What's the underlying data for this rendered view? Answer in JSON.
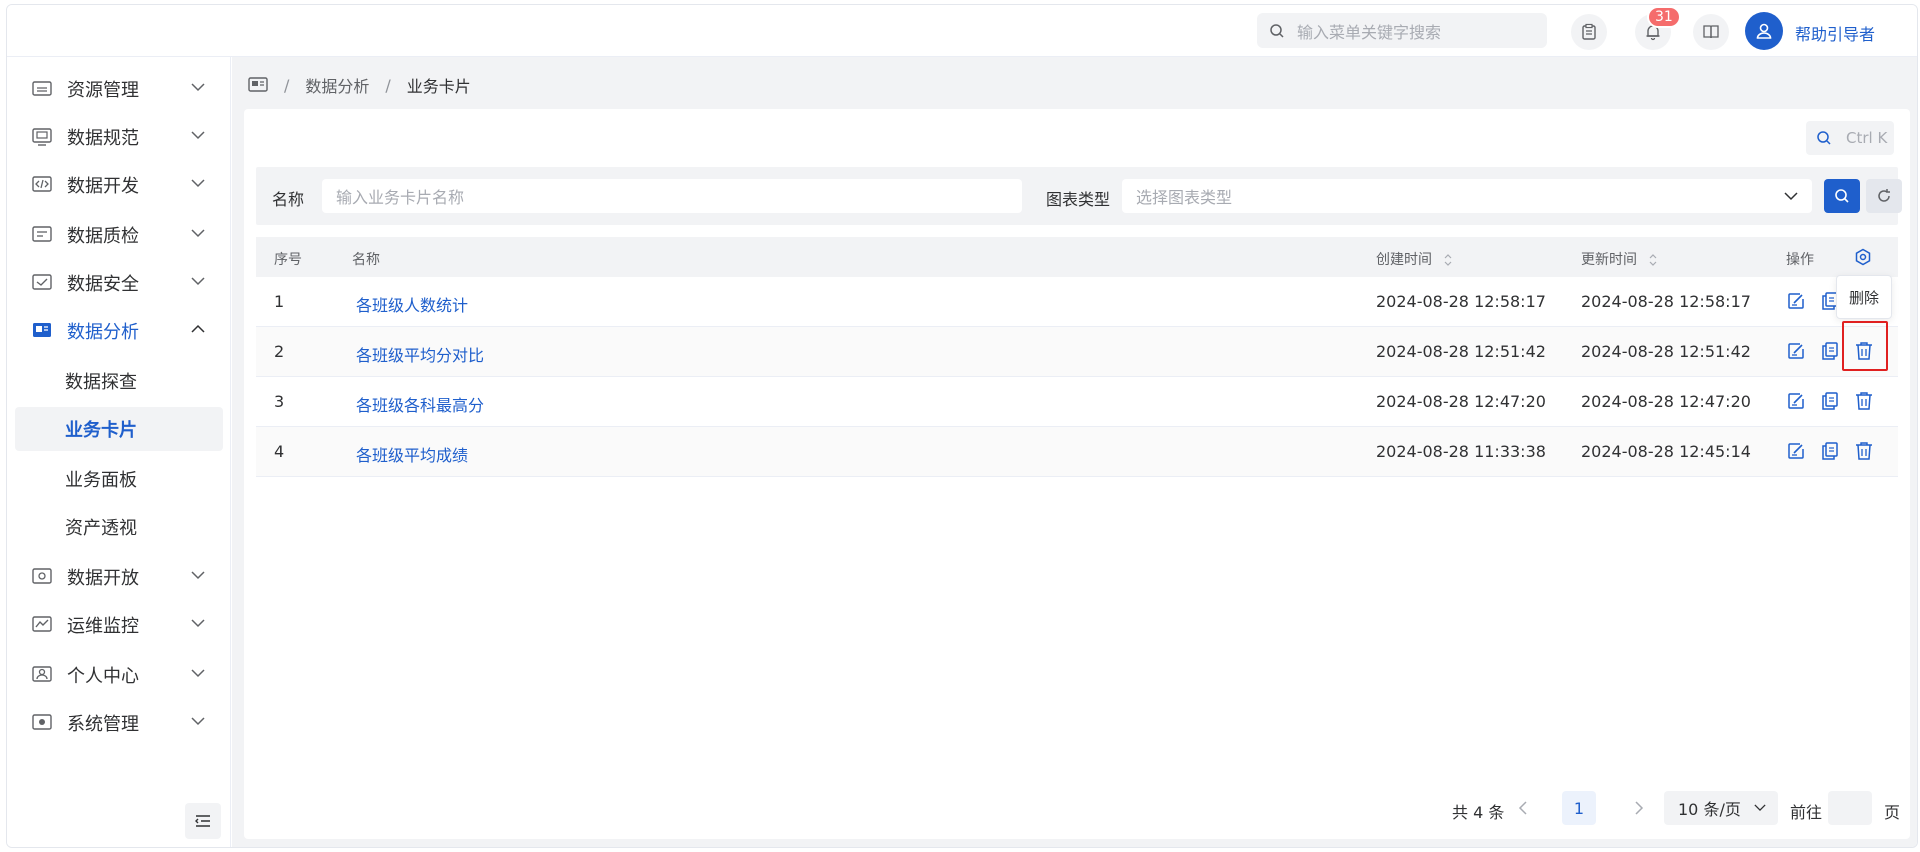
{
  "header": {
    "search_placeholder": "输入菜单关键字搜索",
    "notification_count": "31",
    "user_name": "帮助引导者"
  },
  "sidebar": {
    "items": [
      {
        "label": "资源管理",
        "icon": "resource-icon"
      },
      {
        "label": "数据规范",
        "icon": "standard-icon"
      },
      {
        "label": "数据开发",
        "icon": "code-icon"
      },
      {
        "label": "数据质检",
        "icon": "quality-icon"
      },
      {
        "label": "数据安全",
        "icon": "security-icon"
      },
      {
        "label": "数据分析",
        "icon": "analysis-icon"
      },
      {
        "label": "数据开放",
        "icon": "open-icon"
      },
      {
        "label": "运维监控",
        "icon": "monitor-icon"
      },
      {
        "label": "个人中心",
        "icon": "user-center-icon"
      },
      {
        "label": "系统管理",
        "icon": "system-icon"
      }
    ],
    "sub_items": [
      "数据探查",
      "业务卡片",
      "业务面板",
      "资产透视"
    ]
  },
  "breadcrumb": [
    "数据分析",
    "业务卡片"
  ],
  "toolbar": {
    "shortcut": "Ctrl K"
  },
  "filter": {
    "name_label": "名称",
    "name_placeholder": "输入业务卡片名称",
    "type_label": "图表类型",
    "type_placeholder": "选择图表类型"
  },
  "table": {
    "columns": {
      "index": "序号",
      "name": "名称",
      "created": "创建时间",
      "updated": "更新时间",
      "ops": "操作"
    },
    "rows": [
      {
        "index": "1",
        "name": "各班级人数统计",
        "created": "2024-08-28 12:58:17",
        "updated": "2024-08-28 12:58:17"
      },
      {
        "index": "2",
        "name": "各班级平均分对比",
        "created": "2024-08-28 12:51:42",
        "updated": "2024-08-28 12:51:42"
      },
      {
        "index": "3",
        "name": "各班级各科最高分",
        "created": "2024-08-28 12:47:20",
        "updated": "2024-08-28 12:47:20"
      },
      {
        "index": "4",
        "name": "各班级平均成绩",
        "created": "2024-08-28 11:33:38",
        "updated": "2024-08-28 12:45:14"
      }
    ]
  },
  "tooltip": {
    "delete": "删除"
  },
  "pagination": {
    "total": "共 4 条",
    "current_page": "1",
    "page_size": "10 条/页",
    "goto": "前往",
    "page_unit": "页"
  },
  "colors": {
    "accent": "#1f5fcc",
    "badge": "#f56c6c",
    "highlight": "#e02020"
  }
}
